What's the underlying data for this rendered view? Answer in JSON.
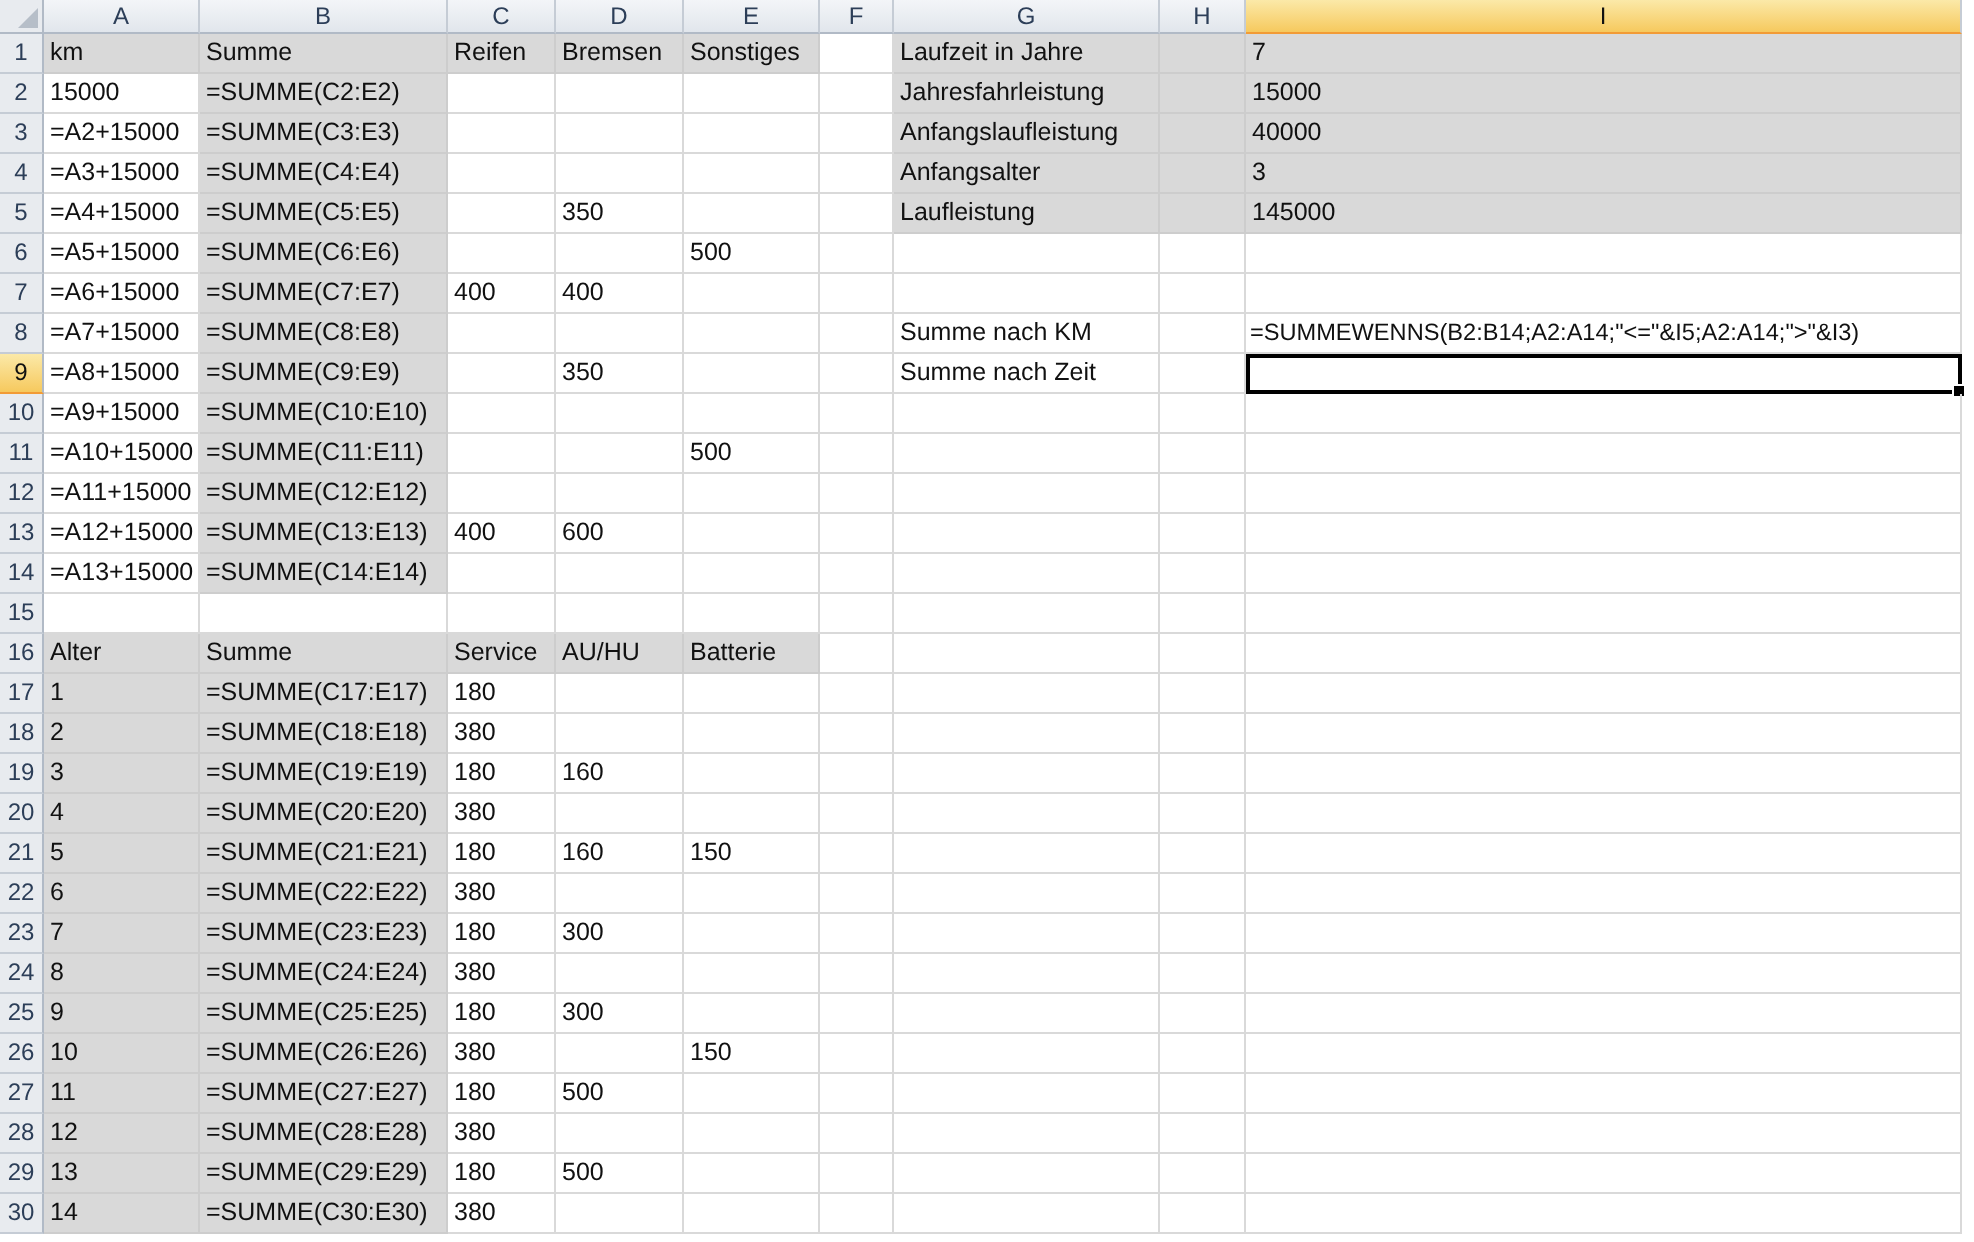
{
  "columns": [
    {
      "letter": "A",
      "selected": false
    },
    {
      "letter": "B",
      "selected": false
    },
    {
      "letter": "C",
      "selected": false
    },
    {
      "letter": "D",
      "selected": false
    },
    {
      "letter": "E",
      "selected": false
    },
    {
      "letter": "F",
      "selected": false
    },
    {
      "letter": "G",
      "selected": false
    },
    {
      "letter": "H",
      "selected": false
    },
    {
      "letter": "I",
      "selected": true
    }
  ],
  "rows": [
    {
      "number": "1",
      "selected": false,
      "cells": [
        {
          "text": "km",
          "shaded": true,
          "selected": false
        },
        {
          "text": "Summe",
          "shaded": true,
          "selected": false
        },
        {
          "text": "Reifen",
          "shaded": true,
          "selected": false
        },
        {
          "text": "Bremsen",
          "shaded": true,
          "selected": false
        },
        {
          "text": "Sonstiges",
          "shaded": true,
          "selected": false
        },
        {
          "shaded": false,
          "selected": false
        },
        {
          "text": "Laufzeit in Jahre",
          "shaded": true,
          "selected": false
        },
        {
          "shaded": true,
          "selected": false
        },
        {
          "text": "7",
          "shaded": true,
          "selected": false
        }
      ]
    },
    {
      "number": "2",
      "selected": false,
      "cells": [
        {
          "text": "15000",
          "shaded": false,
          "selected": false
        },
        {
          "text": "=SUMME(C2:E2)",
          "shaded": true,
          "selected": false
        },
        {
          "shaded": false,
          "selected": false
        },
        {
          "shaded": false,
          "selected": false
        },
        {
          "shaded": false,
          "selected": false
        },
        {
          "shaded": false,
          "selected": false
        },
        {
          "text": "Jahresfahrleistung",
          "shaded": true,
          "selected": false
        },
        {
          "shaded": true,
          "selected": false
        },
        {
          "text": "15000",
          "shaded": true,
          "selected": false
        }
      ]
    },
    {
      "number": "3",
      "selected": false,
      "cells": [
        {
          "text": "=A2+15000",
          "shaded": false,
          "selected": false
        },
        {
          "text": "=SUMME(C3:E3)",
          "shaded": true,
          "selected": false
        },
        {
          "shaded": false,
          "selected": false
        },
        {
          "shaded": false,
          "selected": false
        },
        {
          "shaded": false,
          "selected": false
        },
        {
          "shaded": false,
          "selected": false
        },
        {
          "text": "Anfangslaufleistung",
          "shaded": true,
          "selected": false
        },
        {
          "shaded": true,
          "selected": false
        },
        {
          "text": "40000",
          "shaded": true,
          "selected": false
        }
      ]
    },
    {
      "number": "4",
      "selected": false,
      "cells": [
        {
          "text": "=A3+15000",
          "shaded": false,
          "selected": false
        },
        {
          "text": "=SUMME(C4:E4)",
          "shaded": true,
          "selected": false
        },
        {
          "shaded": false,
          "selected": false
        },
        {
          "shaded": false,
          "selected": false
        },
        {
          "shaded": false,
          "selected": false
        },
        {
          "shaded": false,
          "selected": false
        },
        {
          "text": "Anfangsalter",
          "shaded": true,
          "selected": false
        },
        {
          "shaded": true,
          "selected": false
        },
        {
          "text": "3",
          "shaded": true,
          "selected": false
        }
      ]
    },
    {
      "number": "5",
      "selected": false,
      "cells": [
        {
          "text": "=A4+15000",
          "shaded": false,
          "selected": false
        },
        {
          "text": "=SUMME(C5:E5)",
          "shaded": true,
          "selected": false
        },
        {
          "shaded": false,
          "selected": false
        },
        {
          "text": "350",
          "shaded": false,
          "selected": false
        },
        {
          "shaded": false,
          "selected": false
        },
        {
          "shaded": false,
          "selected": false
        },
        {
          "text": "Laufleistung",
          "shaded": true,
          "selected": false
        },
        {
          "shaded": true,
          "selected": false
        },
        {
          "text": "145000",
          "shaded": true,
          "selected": false
        }
      ]
    },
    {
      "number": "6",
      "selected": false,
      "cells": [
        {
          "text": "=A5+15000",
          "shaded": false,
          "selected": false
        },
        {
          "text": "=SUMME(C6:E6)",
          "shaded": true,
          "selected": false
        },
        {
          "shaded": false,
          "selected": false
        },
        {
          "shaded": false,
          "selected": false
        },
        {
          "text": "500",
          "shaded": false,
          "selected": false
        },
        {
          "shaded": false,
          "selected": false
        },
        {
          "shaded": false,
          "selected": false
        },
        {
          "shaded": false,
          "selected": false
        },
        {
          "shaded": false,
          "selected": false
        }
      ]
    },
    {
      "number": "7",
      "selected": false,
      "cells": [
        {
          "text": "=A6+15000",
          "shaded": false,
          "selected": false
        },
        {
          "text": "=SUMME(C7:E7)",
          "shaded": true,
          "selected": false
        },
        {
          "text": "400",
          "shaded": false,
          "selected": false
        },
        {
          "text": "400",
          "shaded": false,
          "selected": false
        },
        {
          "shaded": false,
          "selected": false
        },
        {
          "shaded": false,
          "selected": false
        },
        {
          "shaded": false,
          "selected": false
        },
        {
          "shaded": false,
          "selected": false
        },
        {
          "shaded": false,
          "selected": false
        }
      ]
    },
    {
      "number": "8",
      "selected": false,
      "cells": [
        {
          "text": "=A7+15000",
          "shaded": false,
          "selected": false
        },
        {
          "text": "=SUMME(C8:E8)",
          "shaded": true,
          "selected": false
        },
        {
          "shaded": false,
          "selected": false
        },
        {
          "shaded": false,
          "selected": false
        },
        {
          "shaded": false,
          "selected": false
        },
        {
          "shaded": false,
          "selected": false
        },
        {
          "text": "Summe nach KM",
          "shaded": false,
          "selected": false
        },
        {
          "shaded": false,
          "selected": false
        },
        {
          "text": "=SUMMEWENNS(B2:B14;A2:A14;\"<=\"&I5;A2:A14;\">\"&I3)",
          "shaded": false,
          "selected": false,
          "kind": "formula"
        }
      ]
    },
    {
      "number": "9",
      "selected": true,
      "cells": [
        {
          "text": "=A8+15000",
          "shaded": false,
          "selected": false
        },
        {
          "text": "=SUMME(C9:E9)",
          "shaded": true,
          "selected": false
        },
        {
          "shaded": false,
          "selected": false
        },
        {
          "text": "350",
          "shaded": false,
          "selected": false
        },
        {
          "shaded": false,
          "selected": false
        },
        {
          "shaded": false,
          "selected": false
        },
        {
          "text": "Summe nach Zeit",
          "shaded": false,
          "selected": false
        },
        {
          "shaded": false,
          "selected": false
        },
        {
          "shaded": false,
          "selected": true
        }
      ]
    },
    {
      "number": "10",
      "selected": false,
      "cells": [
        {
          "text": "=A9+15000",
          "shaded": false,
          "selected": false
        },
        {
          "text": "=SUMME(C10:E10)",
          "shaded": true,
          "selected": false
        },
        {
          "shaded": false,
          "selected": false
        },
        {
          "shaded": false,
          "selected": false
        },
        {
          "shaded": false,
          "selected": false
        },
        {
          "shaded": false,
          "selected": false
        },
        {
          "shaded": false,
          "selected": false
        },
        {
          "shaded": false,
          "selected": false
        },
        {
          "shaded": false,
          "selected": false
        }
      ]
    },
    {
      "number": "11",
      "selected": false,
      "cells": [
        {
          "text": "=A10+15000",
          "shaded": false,
          "selected": false
        },
        {
          "text": "=SUMME(C11:E11)",
          "shaded": true,
          "selected": false
        },
        {
          "shaded": false,
          "selected": false
        },
        {
          "shaded": false,
          "selected": false
        },
        {
          "text": "500",
          "shaded": false,
          "selected": false
        },
        {
          "shaded": false,
          "selected": false
        },
        {
          "shaded": false,
          "selected": false
        },
        {
          "shaded": false,
          "selected": false
        },
        {
          "shaded": false,
          "selected": false
        }
      ]
    },
    {
      "number": "12",
      "selected": false,
      "cells": [
        {
          "text": "=A11+15000",
          "shaded": false,
          "selected": false
        },
        {
          "text": "=SUMME(C12:E12)",
          "shaded": true,
          "selected": false
        },
        {
          "shaded": false,
          "selected": false
        },
        {
          "shaded": false,
          "selected": false
        },
        {
          "shaded": false,
          "selected": false
        },
        {
          "shaded": false,
          "selected": false
        },
        {
          "shaded": false,
          "selected": false
        },
        {
          "shaded": false,
          "selected": false
        },
        {
          "shaded": false,
          "selected": false
        }
      ]
    },
    {
      "number": "13",
      "selected": false,
      "cells": [
        {
          "text": "=A12+15000",
          "shaded": false,
          "selected": false
        },
        {
          "text": "=SUMME(C13:E13)",
          "shaded": true,
          "selected": false
        },
        {
          "text": "400",
          "shaded": false,
          "selected": false
        },
        {
          "text": "600",
          "shaded": false,
          "selected": false
        },
        {
          "shaded": false,
          "selected": false
        },
        {
          "shaded": false,
          "selected": false
        },
        {
          "shaded": false,
          "selected": false
        },
        {
          "shaded": false,
          "selected": false
        },
        {
          "shaded": false,
          "selected": false
        }
      ]
    },
    {
      "number": "14",
      "selected": false,
      "cells": [
        {
          "text": "=A13+15000",
          "shaded": false,
          "selected": false
        },
        {
          "text": "=SUMME(C14:E14)",
          "shaded": true,
          "selected": false
        },
        {
          "shaded": false,
          "selected": false
        },
        {
          "shaded": false,
          "selected": false
        },
        {
          "shaded": false,
          "selected": false
        },
        {
          "shaded": false,
          "selected": false
        },
        {
          "shaded": false,
          "selected": false
        },
        {
          "shaded": false,
          "selected": false
        },
        {
          "shaded": false,
          "selected": false
        }
      ]
    },
    {
      "number": "15",
      "selected": false,
      "cells": [
        {
          "shaded": false,
          "selected": false
        },
        {
          "shaded": false,
          "selected": false
        },
        {
          "shaded": false,
          "selected": false
        },
        {
          "shaded": false,
          "selected": false
        },
        {
          "shaded": false,
          "selected": false
        },
        {
          "shaded": false,
          "selected": false
        },
        {
          "shaded": false,
          "selected": false
        },
        {
          "shaded": false,
          "selected": false
        },
        {
          "shaded": false,
          "selected": false
        }
      ]
    },
    {
      "number": "16",
      "selected": false,
      "cells": [
        {
          "text": "Alter",
          "shaded": true,
          "selected": false
        },
        {
          "text": "Summe",
          "shaded": true,
          "selected": false
        },
        {
          "text": "Service",
          "shaded": true,
          "selected": false
        },
        {
          "text": "AU/HU",
          "shaded": true,
          "selected": false
        },
        {
          "text": "Batterie",
          "shaded": true,
          "selected": false
        },
        {
          "shaded": false,
          "selected": false
        },
        {
          "shaded": false,
          "selected": false
        },
        {
          "shaded": false,
          "selected": false
        },
        {
          "shaded": false,
          "selected": false
        }
      ]
    },
    {
      "number": "17",
      "selected": false,
      "cells": [
        {
          "text": "1",
          "shaded": true,
          "selected": false
        },
        {
          "text": "=SUMME(C17:E17)",
          "shaded": true,
          "selected": false
        },
        {
          "text": "180",
          "shaded": false,
          "selected": false
        },
        {
          "shaded": false,
          "selected": false
        },
        {
          "shaded": false,
          "selected": false
        },
        {
          "shaded": false,
          "selected": false
        },
        {
          "shaded": false,
          "selected": false
        },
        {
          "shaded": false,
          "selected": false
        },
        {
          "shaded": false,
          "selected": false
        }
      ]
    },
    {
      "number": "18",
      "selected": false,
      "cells": [
        {
          "text": "2",
          "shaded": true,
          "selected": false
        },
        {
          "text": "=SUMME(C18:E18)",
          "shaded": true,
          "selected": false
        },
        {
          "text": "380",
          "shaded": false,
          "selected": false
        },
        {
          "shaded": false,
          "selected": false
        },
        {
          "shaded": false,
          "selected": false
        },
        {
          "shaded": false,
          "selected": false
        },
        {
          "shaded": false,
          "selected": false
        },
        {
          "shaded": false,
          "selected": false
        },
        {
          "shaded": false,
          "selected": false
        }
      ]
    },
    {
      "number": "19",
      "selected": false,
      "cells": [
        {
          "text": "3",
          "shaded": true,
          "selected": false
        },
        {
          "text": "=SUMME(C19:E19)",
          "shaded": true,
          "selected": false
        },
        {
          "text": "180",
          "shaded": false,
          "selected": false
        },
        {
          "text": "160",
          "shaded": false,
          "selected": false
        },
        {
          "shaded": false,
          "selected": false
        },
        {
          "shaded": false,
          "selected": false
        },
        {
          "shaded": false,
          "selected": false
        },
        {
          "shaded": false,
          "selected": false
        },
        {
          "shaded": false,
          "selected": false
        }
      ]
    },
    {
      "number": "20",
      "selected": false,
      "cells": [
        {
          "text": "4",
          "shaded": true,
          "selected": false
        },
        {
          "text": "=SUMME(C20:E20)",
          "shaded": true,
          "selected": false
        },
        {
          "text": "380",
          "shaded": false,
          "selected": false
        },
        {
          "shaded": false,
          "selected": false
        },
        {
          "shaded": false,
          "selected": false
        },
        {
          "shaded": false,
          "selected": false
        },
        {
          "shaded": false,
          "selected": false
        },
        {
          "shaded": false,
          "selected": false
        },
        {
          "shaded": false,
          "selected": false
        }
      ]
    },
    {
      "number": "21",
      "selected": false,
      "cells": [
        {
          "text": "5",
          "shaded": true,
          "selected": false
        },
        {
          "text": "=SUMME(C21:E21)",
          "shaded": true,
          "selected": false
        },
        {
          "text": "180",
          "shaded": false,
          "selected": false
        },
        {
          "text": "160",
          "shaded": false,
          "selected": false
        },
        {
          "text": "150",
          "shaded": false,
          "selected": false
        },
        {
          "shaded": false,
          "selected": false
        },
        {
          "shaded": false,
          "selected": false
        },
        {
          "shaded": false,
          "selected": false
        },
        {
          "shaded": false,
          "selected": false
        }
      ]
    },
    {
      "number": "22",
      "selected": false,
      "cells": [
        {
          "text": "6",
          "shaded": true,
          "selected": false
        },
        {
          "text": "=SUMME(C22:E22)",
          "shaded": true,
          "selected": false
        },
        {
          "text": "380",
          "shaded": false,
          "selected": false
        },
        {
          "shaded": false,
          "selected": false
        },
        {
          "shaded": false,
          "selected": false
        },
        {
          "shaded": false,
          "selected": false
        },
        {
          "shaded": false,
          "selected": false
        },
        {
          "shaded": false,
          "selected": false
        },
        {
          "shaded": false,
          "selected": false
        }
      ]
    },
    {
      "number": "23",
      "selected": false,
      "cells": [
        {
          "text": "7",
          "shaded": true,
          "selected": false
        },
        {
          "text": "=SUMME(C23:E23)",
          "shaded": true,
          "selected": false
        },
        {
          "text": "180",
          "shaded": false,
          "selected": false
        },
        {
          "text": "300",
          "shaded": false,
          "selected": false
        },
        {
          "shaded": false,
          "selected": false
        },
        {
          "shaded": false,
          "selected": false
        },
        {
          "shaded": false,
          "selected": false
        },
        {
          "shaded": false,
          "selected": false
        },
        {
          "shaded": false,
          "selected": false
        }
      ]
    },
    {
      "number": "24",
      "selected": false,
      "cells": [
        {
          "text": "8",
          "shaded": true,
          "selected": false
        },
        {
          "text": "=SUMME(C24:E24)",
          "shaded": true,
          "selected": false
        },
        {
          "text": "380",
          "shaded": false,
          "selected": false
        },
        {
          "shaded": false,
          "selected": false
        },
        {
          "shaded": false,
          "selected": false
        },
        {
          "shaded": false,
          "selected": false
        },
        {
          "shaded": false,
          "selected": false
        },
        {
          "shaded": false,
          "selected": false
        },
        {
          "shaded": false,
          "selected": false
        }
      ]
    },
    {
      "number": "25",
      "selected": false,
      "cells": [
        {
          "text": "9",
          "shaded": true,
          "selected": false
        },
        {
          "text": "=SUMME(C25:E25)",
          "shaded": true,
          "selected": false
        },
        {
          "text": "180",
          "shaded": false,
          "selected": false
        },
        {
          "text": "300",
          "shaded": false,
          "selected": false
        },
        {
          "shaded": false,
          "selected": false
        },
        {
          "shaded": false,
          "selected": false
        },
        {
          "shaded": false,
          "selected": false
        },
        {
          "shaded": false,
          "selected": false
        },
        {
          "shaded": false,
          "selected": false
        }
      ]
    },
    {
      "number": "26",
      "selected": false,
      "cells": [
        {
          "text": "10",
          "shaded": true,
          "selected": false
        },
        {
          "text": "=SUMME(C26:E26)",
          "shaded": true,
          "selected": false
        },
        {
          "text": "380",
          "shaded": false,
          "selected": false
        },
        {
          "shaded": false,
          "selected": false
        },
        {
          "text": "150",
          "shaded": false,
          "selected": false
        },
        {
          "shaded": false,
          "selected": false
        },
        {
          "shaded": false,
          "selected": false
        },
        {
          "shaded": false,
          "selected": false
        },
        {
          "shaded": false,
          "selected": false
        }
      ]
    },
    {
      "number": "27",
      "selected": false,
      "cells": [
        {
          "text": "11",
          "shaded": true,
          "selected": false
        },
        {
          "text": "=SUMME(C27:E27)",
          "shaded": true,
          "selected": false
        },
        {
          "text": "180",
          "shaded": false,
          "selected": false
        },
        {
          "text": "500",
          "shaded": false,
          "selected": false
        },
        {
          "shaded": false,
          "selected": false
        },
        {
          "shaded": false,
          "selected": false
        },
        {
          "shaded": false,
          "selected": false
        },
        {
          "shaded": false,
          "selected": false
        },
        {
          "shaded": false,
          "selected": false
        }
      ]
    },
    {
      "number": "28",
      "selected": false,
      "cells": [
        {
          "text": "12",
          "shaded": true,
          "selected": false
        },
        {
          "text": "=SUMME(C28:E28)",
          "shaded": true,
          "selected": false
        },
        {
          "text": "380",
          "shaded": false,
          "selected": false
        },
        {
          "shaded": false,
          "selected": false
        },
        {
          "shaded": false,
          "selected": false
        },
        {
          "shaded": false,
          "selected": false
        },
        {
          "shaded": false,
          "selected": false
        },
        {
          "shaded": false,
          "selected": false
        },
        {
          "shaded": false,
          "selected": false
        }
      ]
    },
    {
      "number": "29",
      "selected": false,
      "cells": [
        {
          "text": "13",
          "shaded": true,
          "selected": false
        },
        {
          "text": "=SUMME(C29:E29)",
          "shaded": true,
          "selected": false
        },
        {
          "text": "180",
          "shaded": false,
          "selected": false
        },
        {
          "text": "500",
          "shaded": false,
          "selected": false
        },
        {
          "shaded": false,
          "selected": false
        },
        {
          "shaded": false,
          "selected": false
        },
        {
          "shaded": false,
          "selected": false
        },
        {
          "shaded": false,
          "selected": false
        },
        {
          "shaded": false,
          "selected": false
        }
      ]
    },
    {
      "number": "30",
      "selected": false,
      "cells": [
        {
          "text": "14",
          "shaded": true,
          "selected": false
        },
        {
          "text": "=SUMME(C30:E30)",
          "shaded": true,
          "selected": false
        },
        {
          "text": "380",
          "shaded": false,
          "selected": false
        },
        {
          "shaded": false,
          "selected": false
        },
        {
          "shaded": false,
          "selected": false
        },
        {
          "shaded": false,
          "selected": false
        },
        {
          "shaded": false,
          "selected": false
        },
        {
          "shaded": false,
          "selected": false
        },
        {
          "shaded": false,
          "selected": false
        }
      ]
    }
  ]
}
